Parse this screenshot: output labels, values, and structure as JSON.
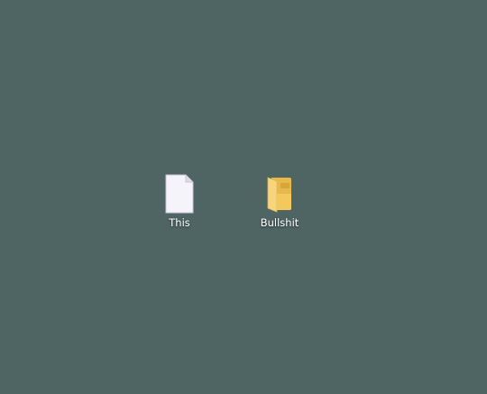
{
  "desktop": {
    "background_color": "#4e6563",
    "icons": [
      {
        "label": "This",
        "icon": "blank-document-icon"
      },
      {
        "label": "Bullshit",
        "icon": "folder-icon"
      }
    ]
  }
}
